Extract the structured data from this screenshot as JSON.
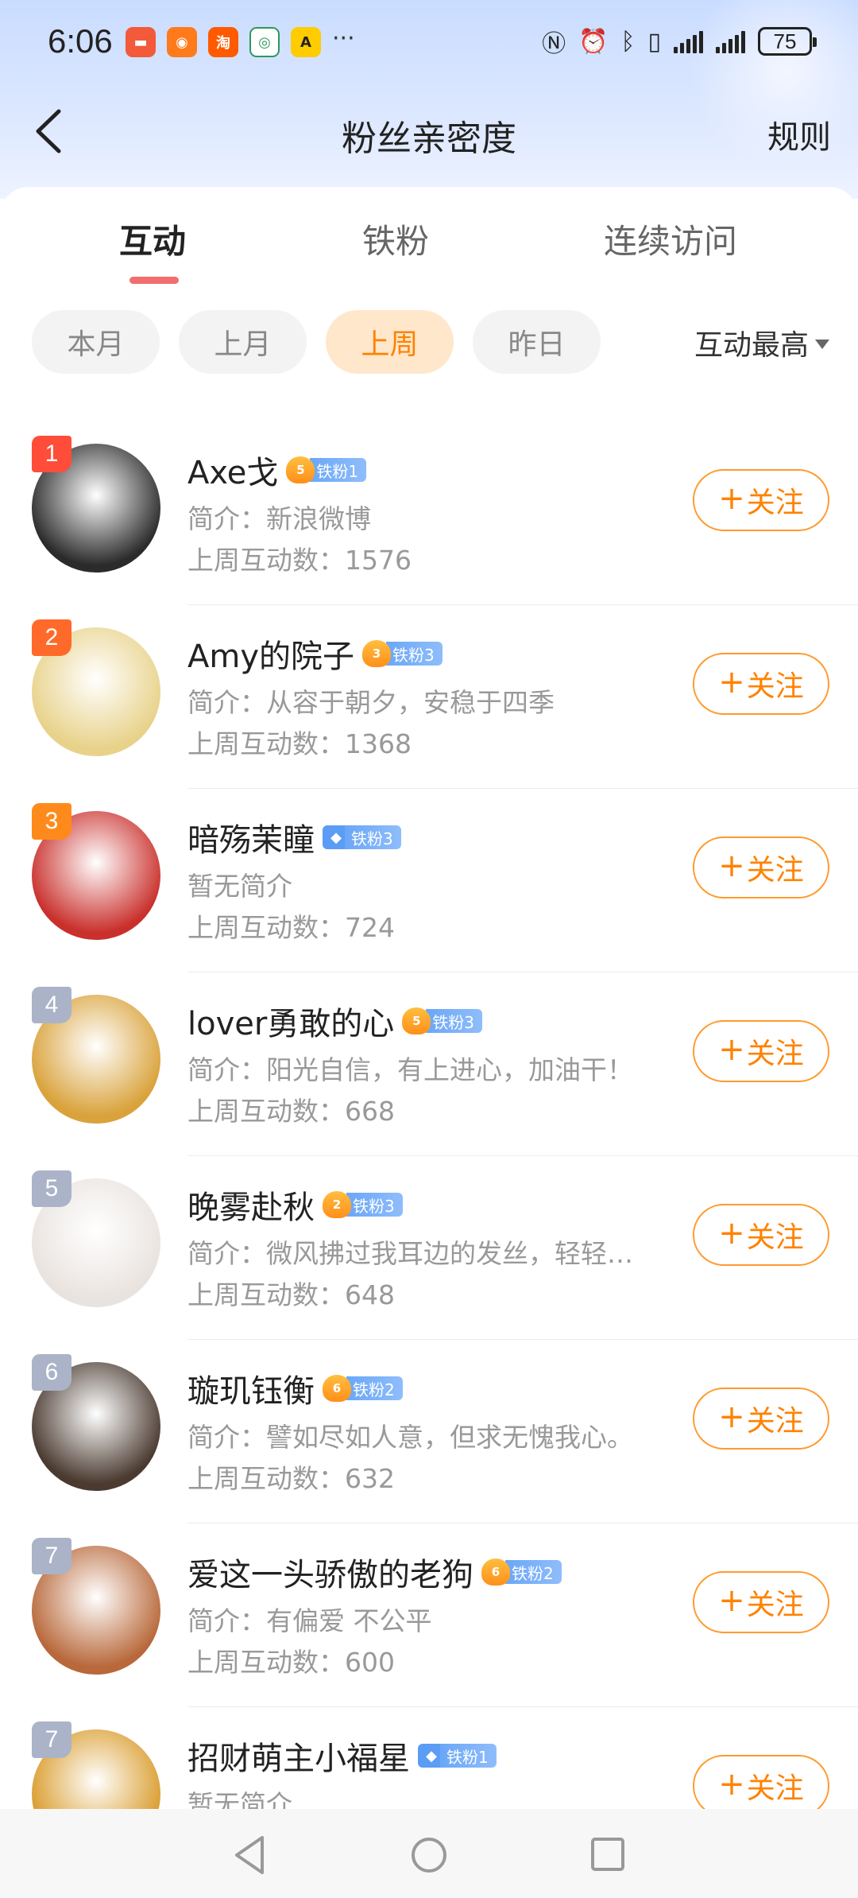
{
  "status_bar": {
    "time": "6:06",
    "battery": "75",
    "notif_icons": [
      "app-icon-red",
      "app-icon-orange",
      "taobao-icon",
      "bank-icon",
      "yellow-app-icon"
    ],
    "more": "···"
  },
  "nav": {
    "title": "粉丝亲密度",
    "rule_label": "规则"
  },
  "tabs": [
    {
      "label": "互动",
      "active": true
    },
    {
      "label": "铁粉",
      "active": false
    },
    {
      "label": "连续访问",
      "active": false
    }
  ],
  "filters": [
    {
      "label": "本月",
      "active": false
    },
    {
      "label": "上月",
      "active": false
    },
    {
      "label": "上周",
      "active": true
    },
    {
      "label": "昨日",
      "active": false
    }
  ],
  "sort_label": "互动最高",
  "follow_label": "关注",
  "fans": [
    {
      "rank": "1",
      "name": "Axe戈",
      "badge_type": "crown",
      "badge_level": "5",
      "badge_text": "铁粉1",
      "bio": "简介：新浪微博",
      "count": "上周互动数：1576",
      "avatar_color": "#2b2b2b"
    },
    {
      "rank": "2",
      "name": "Amy的院子",
      "badge_type": "crown",
      "badge_level": "3",
      "badge_text": "铁粉3",
      "bio": "简介：从容于朝夕，安稳于四季",
      "count": "上周互动数：1368",
      "avatar_color": "#e8d28a"
    },
    {
      "rank": "3",
      "name": "暗殇茉瞳",
      "badge_type": "gem",
      "badge_level": "",
      "badge_text": "铁粉3",
      "bio": "暂无简介",
      "count": "上周互动数：724",
      "avatar_color": "#c9302c"
    },
    {
      "rank": "4",
      "name": "lover勇敢的心",
      "badge_type": "crown",
      "badge_level": "5",
      "badge_text": "铁粉3",
      "bio": "简介：阳光自信，有上进心，加油干！",
      "count": "上周互动数：668",
      "avatar_color": "#d9a23a"
    },
    {
      "rank": "5",
      "name": "晚雾赴秋",
      "badge_type": "crown",
      "badge_level": "2",
      "badge_text": "铁粉3",
      "bio": "简介：微风拂过我耳边的发丝，轻轻…",
      "count": "上周互动数：648",
      "avatar_color": "#e9e3df"
    },
    {
      "rank": "6",
      "name": "璇玑钰衡",
      "badge_type": "crown",
      "badge_level": "6",
      "badge_text": "铁粉2",
      "bio": "简介：譬如尽如人意，但求无愧我心。",
      "count": "上周互动数：632",
      "avatar_color": "#4a3a30"
    },
    {
      "rank": "7",
      "name": "爱这一头骄傲的老狗",
      "badge_type": "crown",
      "badge_level": "6",
      "badge_text": "铁粉2",
      "bio": "简介：有偏爱 不公平",
      "count": "上周互动数：600",
      "avatar_color": "#b8683a"
    },
    {
      "rank": "7",
      "name": "招财萌主小福星",
      "badge_type": "gem",
      "badge_level": "",
      "badge_text": "铁粉1",
      "bio": "暂无简介",
      "count": "",
      "avatar_color": "#d99b2a"
    }
  ],
  "colors": {
    "accent": "#ff8200",
    "tab_indicator": "#f26d6d",
    "badge_blue": "#6aa7f7"
  }
}
